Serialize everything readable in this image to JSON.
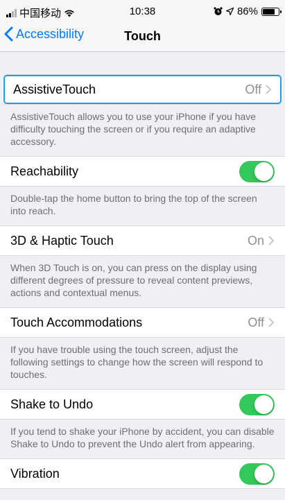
{
  "status_bar": {
    "carrier": "中国移动",
    "time": "10:38",
    "battery_percent": "86%",
    "battery_level": 0.86
  },
  "nav": {
    "back_label": "Accessibility",
    "title": "Touch"
  },
  "rows": [
    {
      "label": "AssistiveTouch",
      "value": "Off",
      "footer": "AssistiveTouch allows you to use your iPhone if you have difficulty touching the screen or if you require an adaptive accessory."
    },
    {
      "label": "Reachability",
      "toggle": true,
      "footer": "Double-tap the home button to bring the top of the screen into reach."
    },
    {
      "label": "3D & Haptic Touch",
      "value": "On",
      "footer": "When 3D Touch is on, you can press on the display using different degrees of pressure to reveal content previews, actions and contextual menus."
    },
    {
      "label": "Touch Accommodations",
      "value": "Off",
      "footer": "If you have trouble using the touch screen, adjust the following settings to change how the screen will respond to touches."
    },
    {
      "label": "Shake to Undo",
      "toggle": true,
      "footer": "If you tend to shake your iPhone by accident, you can disable Shake to Undo to prevent the Undo alert from appearing."
    },
    {
      "label": "Vibration",
      "toggle": true
    }
  ],
  "colors": {
    "accent": "#007aff",
    "toggle_on": "#34c759",
    "highlight": "#1a9ee6"
  }
}
